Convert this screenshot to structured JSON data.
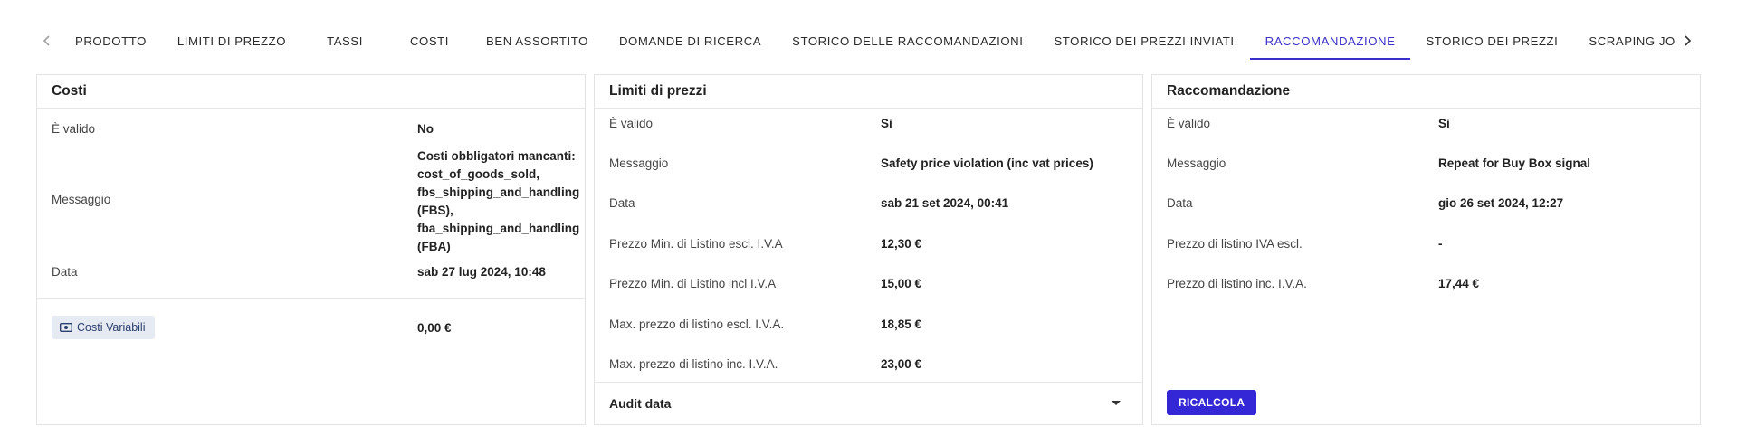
{
  "tabs": {
    "items": [
      {
        "label": "PRODOTTO"
      },
      {
        "label": "LIMITI DI PREZZO"
      },
      {
        "label": "TASSI"
      },
      {
        "label": "COSTI"
      },
      {
        "label": "BEN ASSORTITO"
      },
      {
        "label": "DOMANDE DI RICERCA"
      },
      {
        "label": "STORICO DELLE RACCOMANDAZIONI"
      },
      {
        "label": "STORICO DEI PREZZI INVIATI"
      },
      {
        "label": "RACCOMANDAZIONE",
        "active": true
      },
      {
        "label": "STORICO DEI PREZZI"
      },
      {
        "label": "SCRAPING JOBS"
      }
    ],
    "prev_icon": "chevron-left-icon",
    "next_icon": "chevron-right-icon"
  },
  "costi": {
    "title": "Costi",
    "valido_label": "È valido",
    "valido_value": "No",
    "messaggio_label": "Messaggio",
    "messaggio_lines": [
      "Costi obbligatori mancanti:",
      "cost_of_goods_sold,",
      "fbs_shipping_and_handling",
      "(FBS),",
      "fba_shipping_and_handling",
      "(FBA)"
    ],
    "data_label": "Data",
    "data_value": "sab 27 lug 2024, 10:48",
    "variabili_label": "Costi Variabili",
    "variabili_icon": "money-icon",
    "variabili_value": "0,00 €"
  },
  "limiti": {
    "title": "Limiti di prezzi",
    "rows": [
      {
        "label": "È valido",
        "value": "Si"
      },
      {
        "label": "Messaggio",
        "value": "Safety price violation (inc vat prices)"
      },
      {
        "label": "Data",
        "value": "sab 21 set 2024, 00:41"
      },
      {
        "label": "Prezzo Min. di Listino escl. I.V.A",
        "value": "12,30 €"
      },
      {
        "label": "Prezzo Min. di Listino incl I.V.A",
        "value": "15,00 €"
      },
      {
        "label": "Max. prezzo di listino escl. I.V.A.",
        "value": "18,85 €"
      },
      {
        "label": "Max. prezzo di listino inc. I.V.A.",
        "value": "23,00 €"
      }
    ],
    "audit_label": "Audit data"
  },
  "raccomandazione": {
    "title": "Raccomandazione",
    "rows": [
      {
        "label": "È valido",
        "value": "Si"
      },
      {
        "label": "Messaggio",
        "value": "Repeat for Buy Box signal"
      },
      {
        "label": "Data",
        "value": "gio 26 set 2024, 12:27"
      },
      {
        "label": "Prezzo di listino IVA escl.",
        "value": "-"
      },
      {
        "label": "Prezzo di listino inc. I.V.A.",
        "value": "17,44 €"
      }
    ],
    "button_label": "RICALCOLA"
  }
}
